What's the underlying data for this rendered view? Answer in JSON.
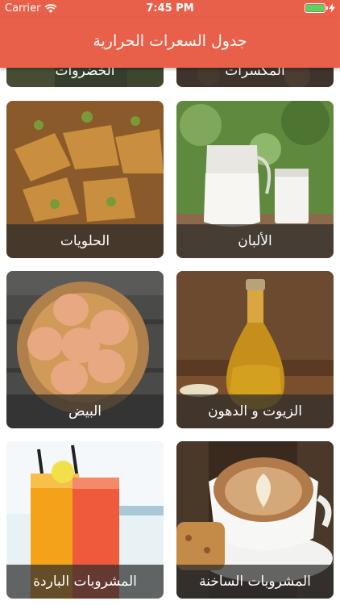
{
  "status_bar": {
    "carrier": "Carrier",
    "time": "7:45 PM",
    "battery_level": 1.0,
    "battery_color": "#4cd964"
  },
  "nav": {
    "title": "جدول السعرات الحرارية",
    "background": "#e9604a"
  },
  "categories": [
    {
      "label": "المكسرات"
    },
    {
      "label": "الخضروات"
    },
    {
      "label": "الألبان"
    },
    {
      "label": "الحلويات"
    },
    {
      "label": "الزيوت و الدهون"
    },
    {
      "label": "البيض"
    },
    {
      "label": "المشروبات الساخنة"
    },
    {
      "label": "المشروبات الباردة"
    }
  ]
}
